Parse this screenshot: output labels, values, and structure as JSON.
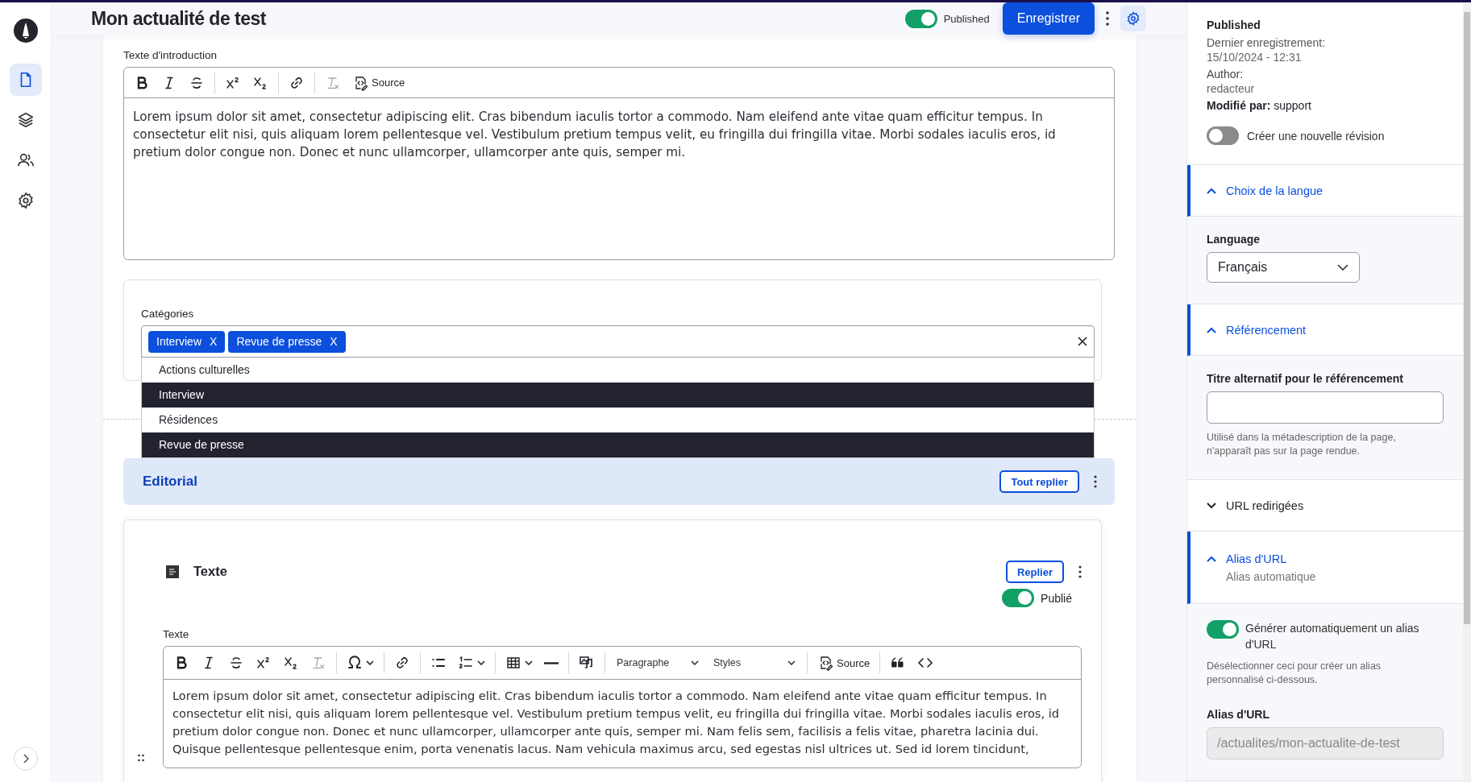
{
  "rail": {
    "items": [
      {
        "kind": "document",
        "selected": true
      },
      {
        "kind": "layers",
        "selected": false
      },
      {
        "kind": "users",
        "selected": false
      },
      {
        "kind": "settings",
        "selected": false
      }
    ]
  },
  "header": {
    "title": "Mon actualité de test",
    "published": {
      "label": "Published",
      "on": true
    },
    "save_button": "Enregistrer",
    "settings_button": {
      "selected": true
    }
  },
  "intro": {
    "label": "Texte d'introduction",
    "toolbar": [
      {
        "kind": "bold",
        "disabled": false
      },
      {
        "kind": "italic",
        "disabled": false
      },
      {
        "kind": "strike",
        "disabled": false
      },
      {
        "kind": "separator"
      },
      {
        "kind": "superscript",
        "disabled": false
      },
      {
        "kind": "subscript",
        "disabled": false
      },
      {
        "kind": "separator"
      },
      {
        "kind": "link",
        "disabled": false
      },
      {
        "kind": "separator"
      },
      {
        "kind": "remove-format",
        "disabled": true
      },
      {
        "kind": "source",
        "label": "Source",
        "disabled": false
      }
    ],
    "text": "Lorem ipsum dolor sit amet, consectetur adipiscing elit. Cras bibendum iaculis tortor a commodo. Nam eleifend ante vitae quam efficitur tempus. In consectetur elit nisi, quis aliquam lorem pellentesque vel. Vestibulum pretium tempus velit, eu fringilla dui fringilla vitae. Morbi sodales iaculis eros, id pretium dolor congue non. Donec et nunc ullamcorper, ullamcorper ante quis, semper mi."
  },
  "categories": {
    "label": "Catégories",
    "tags": [
      {
        "label": "Interview",
        "remove": "X"
      },
      {
        "label": "Revue de presse",
        "remove": "X"
      }
    ],
    "options": [
      {
        "label": "Actions culturelles",
        "selected": false
      },
      {
        "label": "Interview",
        "selected": true
      },
      {
        "label": "Résidences",
        "selected": false
      },
      {
        "label": "Revue de presse",
        "selected": true
      }
    ]
  },
  "section": {
    "title": "Editorial",
    "collapse_all": "Tout replier"
  },
  "paragraph": {
    "title": "Texte",
    "collapse": "Replier",
    "published": {
      "label": "Publié",
      "on": true
    },
    "field_label": "Texte",
    "toolbar": [
      {
        "kind": "bold",
        "disabled": false
      },
      {
        "kind": "italic",
        "disabled": false
      },
      {
        "kind": "strike",
        "disabled": false
      },
      {
        "kind": "superscript",
        "disabled": false
      },
      {
        "kind": "subscript",
        "disabled": false
      },
      {
        "kind": "remove-format",
        "disabled": true
      },
      {
        "kind": "separator"
      },
      {
        "kind": "special-chars",
        "disabled": false
      },
      {
        "kind": "separator"
      },
      {
        "kind": "link",
        "disabled": false
      },
      {
        "kind": "separator"
      },
      {
        "kind": "bullet-list",
        "disabled": false
      },
      {
        "kind": "numbered-list",
        "disabled": false
      },
      {
        "kind": "separator"
      },
      {
        "kind": "table",
        "disabled": false
      },
      {
        "kind": "horizontal-line",
        "disabled": false
      },
      {
        "kind": "separator"
      },
      {
        "kind": "media",
        "disabled": false
      },
      {
        "kind": "separator"
      },
      {
        "kind": "dropdown",
        "label": "Paragraphe"
      },
      {
        "kind": "dropdown",
        "label": "Styles"
      },
      {
        "kind": "separator"
      },
      {
        "kind": "source",
        "label": "Source",
        "disabled": false
      },
      {
        "kind": "separator"
      },
      {
        "kind": "blockquote",
        "disabled": false
      },
      {
        "kind": "code",
        "disabled": false
      }
    ],
    "text": "Lorem ipsum dolor sit amet, consectetur adipiscing elit. Cras bibendum iaculis tortor a commodo. Nam eleifend ante vitae quam efficitur tempus. In consectetur elit nisi, quis aliquam lorem pellentesque vel. Vestibulum pretium tempus velit, eu fringilla dui fringilla vitae. Morbi sodales iaculis eros, id pretium dolor congue non. Donec et nunc ullamcorper, ullamcorper ante quis, semper mi. Nam felis sem, facilisis a felis vitae, pharetra lacinia dui. Quisque pellentesque pellentesque enim, porta venenatis lacus. Nam vehicula maximus arcu, sed egestas nisl ultrices ut. Sed id lorem tincidunt,"
  },
  "sidebar": {
    "status": "Published",
    "last_saved_label": "Dernier enregistrement:",
    "last_saved": "15/10/2024 - 12:31",
    "author_label": "Author:",
    "author": "redacteur",
    "modified_by": "**Modifié par:** support",
    "new_revision": {
      "label": "Créer une nouvelle révision",
      "on": false
    },
    "panels": [
      {
        "title": "Choix de la langue",
        "expanded": true,
        "kind": "select",
        "field_label": "Language",
        "value": "Français"
      },
      {
        "title": "Référencement",
        "expanded": true,
        "kind": "text",
        "field_label": "Titre alternatif pour le référencement",
        "help": "Utilisé dans la métadescription de la page, n'apparaît pas sur la page rendue."
      },
      {
        "title": "URL redirigées",
        "expanded": false
      },
      {
        "title": "Alias d'URL",
        "expanded": true,
        "summary": "Alias automatique",
        "kind": "alias",
        "auto_toggle": {
          "label": "Générer automatiquement un alias d'URL",
          "on": true
        },
        "help": "Désélectionner ceci pour créer un alias personnalisé ci-dessous.",
        "field_label": "Alias d'URL",
        "value": "/actualites/mon-actualite-de-test",
        "disabled": true
      }
    ]
  }
}
